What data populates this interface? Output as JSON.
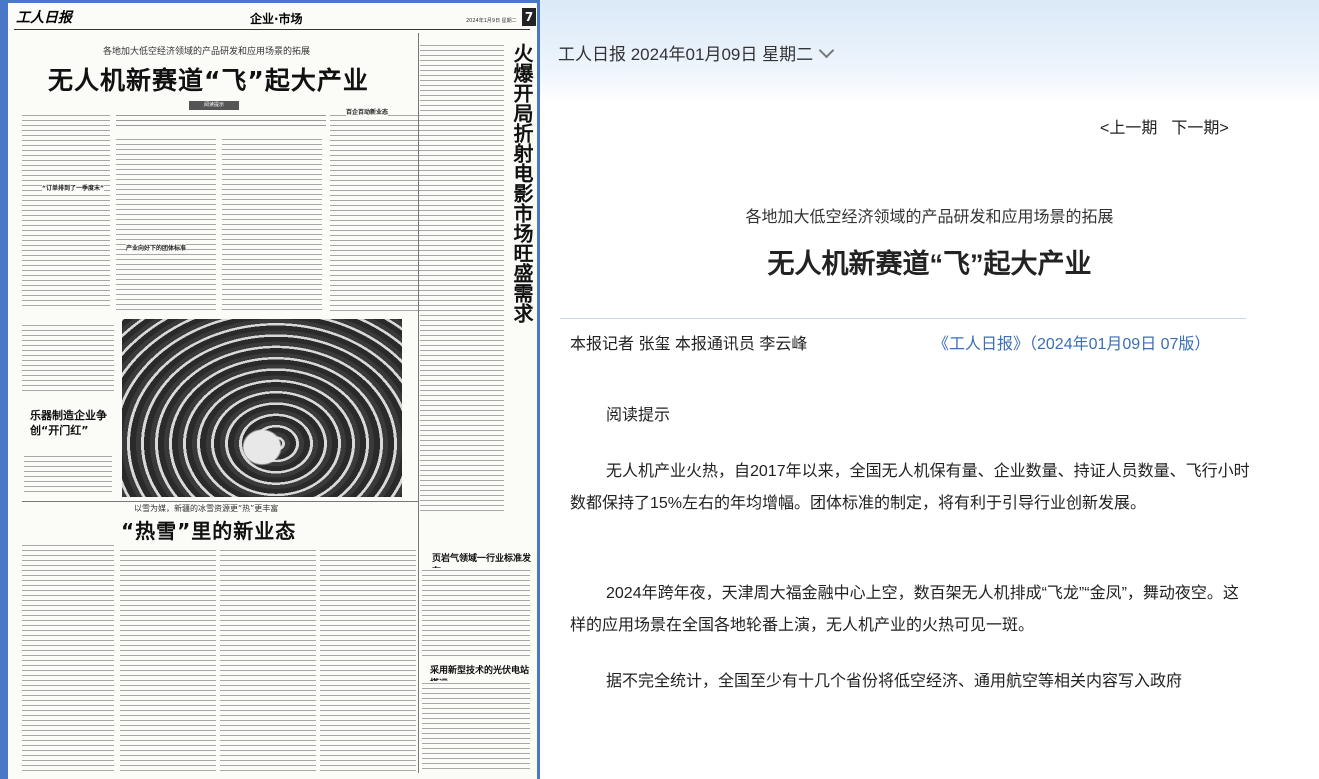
{
  "paper": {
    "logo": "工人日报",
    "section": "企业·市场",
    "date": "2024年1月9日 星期二",
    "page_number": "7",
    "subtitle": "各地加大低空经济领域的产品研发和应用场景的拓展",
    "title": "无人机新赛道“飞”起大产业",
    "hint_label": "阅读提示",
    "vertical_title": "火爆开局折射电影市场旺盛需求",
    "music_title": "乐器制造企业争创“开门红”",
    "snow_subtitle": "以雪为媒，新疆的冰雪资源更“热”更丰富",
    "snow_title": "“热雪”里的新业态",
    "right_head_1": "页岩气领域一行业标准发布",
    "right_head_2": "采用新型技术的光伏电站搭运"
  },
  "reader": {
    "date_select": "工人日报 2024年01月09日 星期二",
    "prev_issue": "<上一期",
    "next_issue": "下一期>",
    "subtitle": "各地加大低空经济领域的产品研发和应用场景的拓展",
    "title": "无人机新赛道“飞”起大产业",
    "byline": "本报记者 张玺 本报通讯员 李云峰",
    "source": "《工人日报》（2024年01月09日 07版）",
    "paragraphs": [
      "阅读提示",
      "无人机产业火热，自2017年以来，全国无人机保有量、企业数量、持证人员数量、飞行小时数都保持了15%左右的年均增幅。团体标准的制定，将有利于引导行业创新发展。",
      "2024年跨年夜，天津周大福金融中心上空，数百架无人机排成“飞龙”“金凤”，舞动夜空。这样的应用场景在全国各地轮番上演，无人机产业的火热可见一斑。",
      "据不完全统计，全国至少有十几个省份将低空经济、通用航空等相关内容写入政府"
    ]
  },
  "colors": {
    "panel_blue": "#4a78c8",
    "link_blue": "#3a6fb5"
  }
}
